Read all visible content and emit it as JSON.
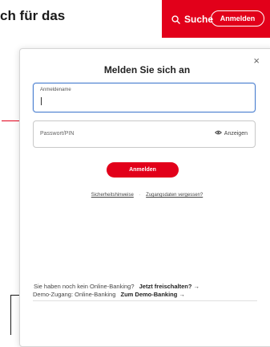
{
  "background": {
    "headline_fragment": "ch für das"
  },
  "topbar": {
    "search_label": "Suche",
    "login_label": "Anmelden"
  },
  "modal": {
    "title": "Melden Sie sich an",
    "close_symbol": "×",
    "username_label": "Anmeldename",
    "username_value": "",
    "password_placeholder": "Passwort/PIN",
    "show_password_label": "Anzeigen",
    "submit_label": "Anmelden",
    "link_security": "Sicherheitshinweise",
    "link_separator": "·",
    "link_forgot": "Zugangsdaten vergessen?",
    "no_banking_text": "Sie haben noch kein Online-Banking?",
    "no_banking_cta": "Jetzt freischalten? →",
    "demo_text": "Demo-Zugang: Online-Banking",
    "demo_cta": "Zum Demo-Banking →"
  },
  "colors": {
    "brand_red": "#e2001a",
    "focus_blue": "#4a7fd0"
  },
  "icons": {
    "search": "search-icon",
    "eye": "eye-icon",
    "close": "close-icon"
  }
}
